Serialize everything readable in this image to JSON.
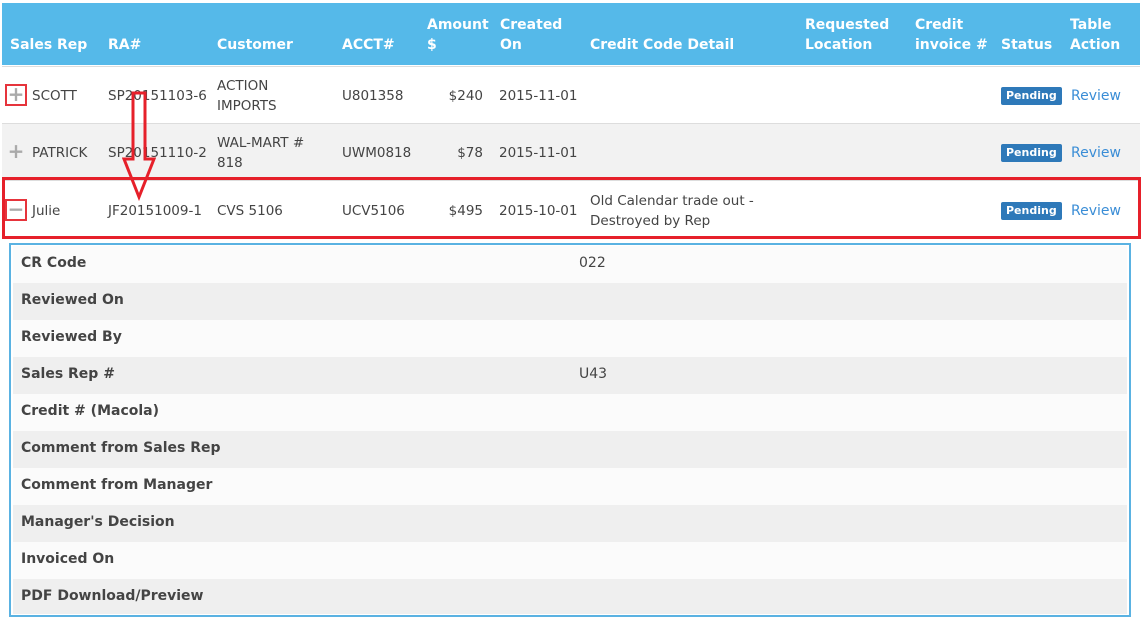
{
  "headers": {
    "sales_rep": "Sales Rep",
    "ra": "RA#",
    "customer": "Customer",
    "acct": "ACCT#",
    "amount": "Amount\n$",
    "created_on": "Created\nOn",
    "credit_code_detail": "Credit Code Detail",
    "requested_location": "Requested\nLocation",
    "credit_invoice": "Credit\ninvoice #",
    "status": "Status",
    "table_action": "Table\nAction"
  },
  "rows": [
    {
      "toggle": "+",
      "sales_rep": "SCOTT",
      "ra": "SP20151103-6",
      "customer": "ACTION\nIMPORTS",
      "acct": "U801358",
      "amount": "$240",
      "created_on": "2015-11-01",
      "credit_code_detail": "",
      "status": "Pending",
      "action": "Review"
    },
    {
      "toggle": "+",
      "sales_rep": "PATRICK",
      "ra": "SP20151110-2",
      "customer": "WAL-MART #\n818",
      "acct": "UWM0818",
      "amount": "$78",
      "created_on": "2015-11-01",
      "credit_code_detail": "",
      "status": "Pending",
      "action": "Review"
    },
    {
      "toggle": "−",
      "sales_rep": "Julie",
      "ra": "JF20151009-1",
      "customer": "CVS 5106",
      "acct": "UCV5106",
      "amount": "$495",
      "created_on": "2015-10-01",
      "credit_code_detail": "Old Calendar trade out -\nDestroyed by Rep",
      "status": "Pending",
      "action": "Review"
    }
  ],
  "detail": [
    {
      "label": "CR Code",
      "value": "022"
    },
    {
      "label": "Reviewed On",
      "value": ""
    },
    {
      "label": "Reviewed By",
      "value": ""
    },
    {
      "label": "Sales Rep #",
      "value": "U43"
    },
    {
      "label": "Credit # (Macola)",
      "value": ""
    },
    {
      "label": "Comment from Sales Rep",
      "value": ""
    },
    {
      "label": "Comment from Manager",
      "value": ""
    },
    {
      "label": "Manager's Decision",
      "value": ""
    },
    {
      "label": "Invoiced On",
      "value": ""
    },
    {
      "label": "PDF Download/Preview",
      "value": ""
    }
  ],
  "colors": {
    "header_bg": "#55b9e9",
    "badge_bg": "#2e79b9",
    "link": "#3a8dd6",
    "annotation_red": "#e6202a",
    "detail_border": "#5ab2e2"
  },
  "icons": {
    "expand": "plus-icon",
    "collapse": "minus-icon",
    "annotation": "down-arrow-icon"
  }
}
